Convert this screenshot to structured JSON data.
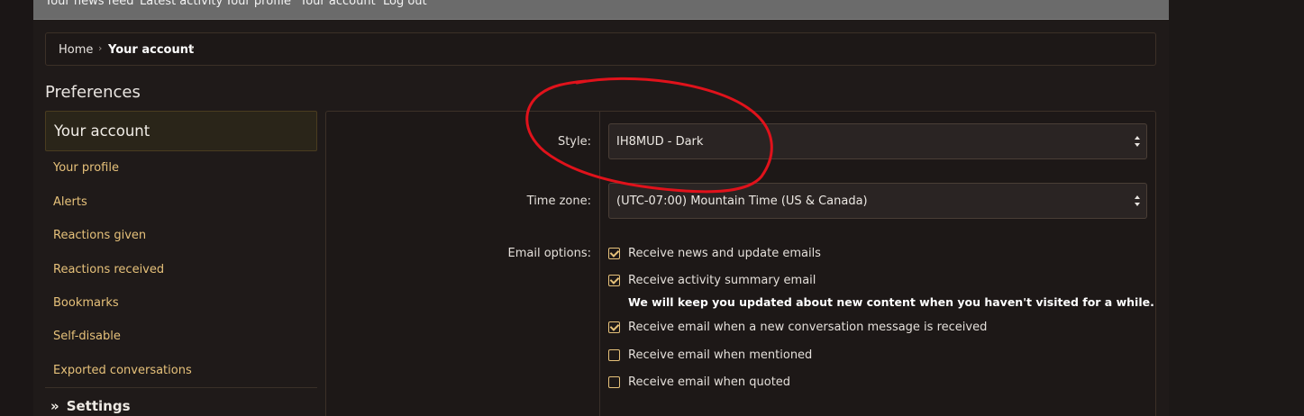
{
  "topnav": {
    "links": [
      "Your news feed",
      "Latest activity",
      "Your profile",
      "Your account",
      "Log out"
    ]
  },
  "breadcrumb": {
    "home": "Home",
    "current": "Your account",
    "separator": "›"
  },
  "page": {
    "title": "Preferences"
  },
  "sidebar": {
    "active": "Your account",
    "items": [
      "Your profile",
      "Alerts",
      "Reactions given",
      "Reactions received",
      "Bookmarks",
      "Self-disable",
      "Exported conversations"
    ],
    "settings": {
      "chevrons": "»",
      "label": "Settings"
    }
  },
  "form": {
    "style": {
      "label": "Style:",
      "value": "IH8MUD - Dark"
    },
    "timezone": {
      "label": "Time zone:",
      "value": "(UTC-07:00) Mountain Time (US & Canada)"
    },
    "email": {
      "label": "Email options:",
      "options": [
        {
          "label": "Receive news and update emails",
          "checked": true
        },
        {
          "label": "Receive activity summary email",
          "checked": true
        },
        {
          "label": "Receive email when a new conversation message is received",
          "checked": true
        },
        {
          "label": "Receive email when mentioned",
          "checked": false
        },
        {
          "label": "Receive email when quoted",
          "checked": false
        }
      ],
      "hint": "We will keep you updated about new content when you haven't visited for a while."
    }
  },
  "colors": {
    "accent": "#e6c17a",
    "annotation": "#e0121b",
    "nav_bg": "#6b6b6b",
    "background": "#1f1a19"
  }
}
